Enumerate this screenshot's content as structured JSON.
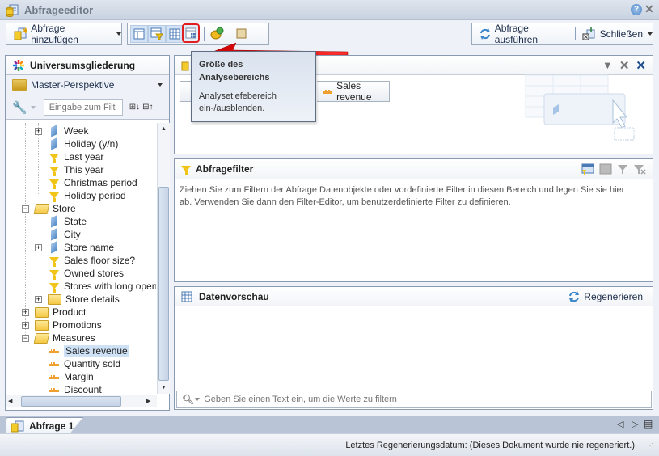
{
  "window": {
    "title": "Abfrageeditor",
    "help_icon": "help-icon",
    "close_icon": "close-icon"
  },
  "toolbar": {
    "add_query_label": "Abfrage hinzufügen",
    "view_buttons": [
      {
        "name": "result-objects-view",
        "icon": "panel-layout-icon"
      },
      {
        "name": "query-filter-view",
        "icon": "filter-panel-icon"
      },
      {
        "name": "data-preview-view",
        "icon": "table-grid-icon"
      },
      {
        "name": "analysis-scope-view",
        "icon": "analysis-scope-icon",
        "highlighted": true
      }
    ],
    "run_query_label": "Abfrage ausführen",
    "close_label": "Schließen"
  },
  "tooltip": {
    "title": "Größe des Analysebereichs",
    "description": "Analysetiefebereich ein-/ausblenden."
  },
  "sidebar": {
    "title": "Universumsgliederung",
    "perspective": "Master-Perspektive",
    "filter_placeholder": "Eingabe zum Filt",
    "tree": [
      {
        "label": "Week",
        "type": "dimension",
        "level": 2,
        "expander": "+"
      },
      {
        "label": "Holiday (y/n)",
        "type": "dimension",
        "level": 2
      },
      {
        "label": "Last year",
        "type": "filter",
        "level": 2
      },
      {
        "label": "This year",
        "type": "filter",
        "level": 2
      },
      {
        "label": "Christmas period",
        "type": "filter",
        "level": 2
      },
      {
        "label": "Holiday period",
        "type": "filter",
        "level": 2
      },
      {
        "label": "Store",
        "type": "folder-open",
        "level": 1,
        "expander": "-"
      },
      {
        "label": "State",
        "type": "dimension",
        "level": 2
      },
      {
        "label": "City",
        "type": "dimension",
        "level": 2
      },
      {
        "label": "Store name",
        "type": "dimension",
        "level": 2,
        "expander": "+"
      },
      {
        "label": "Sales floor size?",
        "type": "filter",
        "level": 2
      },
      {
        "label": "Owned stores",
        "type": "filter",
        "level": 2
      },
      {
        "label": "Stores with long openin",
        "type": "filter",
        "level": 2
      },
      {
        "label": "Store details",
        "type": "folder",
        "level": 2,
        "expander": "+"
      },
      {
        "label": "Product",
        "type": "folder",
        "level": 1,
        "expander": "+"
      },
      {
        "label": "Promotions",
        "type": "folder",
        "level": 1,
        "expander": "+"
      },
      {
        "label": "Measures",
        "type": "folder-open",
        "level": 1,
        "expander": "-"
      },
      {
        "label": "Sales revenue",
        "type": "measure",
        "level": 2,
        "selected": true
      },
      {
        "label": "Quantity sold",
        "type": "measure",
        "level": 2
      },
      {
        "label": "Margin",
        "type": "measure",
        "level": 2
      },
      {
        "label": "Discount",
        "type": "measure",
        "level": 2
      }
    ]
  },
  "result_objects": {
    "chips": [
      {
        "label": "Sales revenue",
        "type": "measure"
      }
    ]
  },
  "query_filter": {
    "title": "Abfragefilter",
    "hint": "Ziehen Sie zum Filtern der Abfrage Datenobjekte oder vordefinierte Filter in diesen Bereich und legen Sie sie hier ab. Verwenden Sie dann den Filter-Editor, um benutzerdefinierte Filter zu definieren."
  },
  "data_preview": {
    "title": "Datenvorschau",
    "refresh_label": "Regenerieren",
    "search_placeholder": "Geben Sie einen Text ein, um die Werte zu filtern"
  },
  "tabs": [
    {
      "label": "Abfrage 1",
      "active": true
    }
  ],
  "status": {
    "text": "Letztes Regenerierungsdatum: (Dieses Dokument wurde nie regeneriert.)"
  },
  "colors": {
    "highlight_red": "#e02020",
    "selection": "#cfe1f5",
    "accent_blue": "#1c6fc0"
  }
}
